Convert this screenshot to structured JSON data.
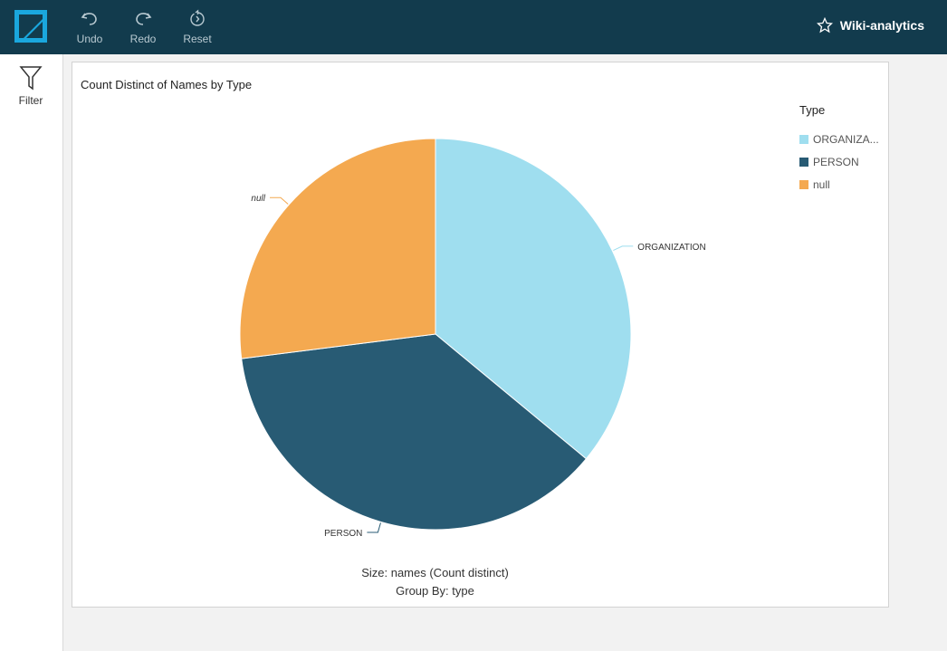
{
  "header": {
    "logo_icon": "quicksight-logo-icon",
    "tools": [
      {
        "label": "Undo",
        "icon": "undo-icon"
      },
      {
        "label": "Redo",
        "icon": "redo-icon"
      },
      {
        "label": "Reset",
        "icon": "reset-icon"
      }
    ],
    "analysis_name": "Wiki-analytics",
    "favorite_icon": "star-icon"
  },
  "sidebar": {
    "filter_label": "Filter",
    "filter_icon": "filter-icon"
  },
  "visual": {
    "title": "Count Distinct of Names by Type",
    "footer_size": "Size: names (Count distinct)",
    "footer_group": "Group By: type"
  },
  "chart_data": {
    "type": "pie",
    "title": "Count Distinct of Names by Type",
    "legend_title": "Type",
    "legend_position": "top-right",
    "slices": [
      {
        "label": "ORGANIZATION",
        "legend_label": "ORGANIZA...",
        "value": 36,
        "color": "#9fdeef"
      },
      {
        "label": "PERSON",
        "legend_label": "PERSON",
        "value": 37,
        "color": "#285b74"
      },
      {
        "label": "null",
        "legend_label": "null",
        "value": 27,
        "color": "#f4a950"
      }
    ]
  }
}
